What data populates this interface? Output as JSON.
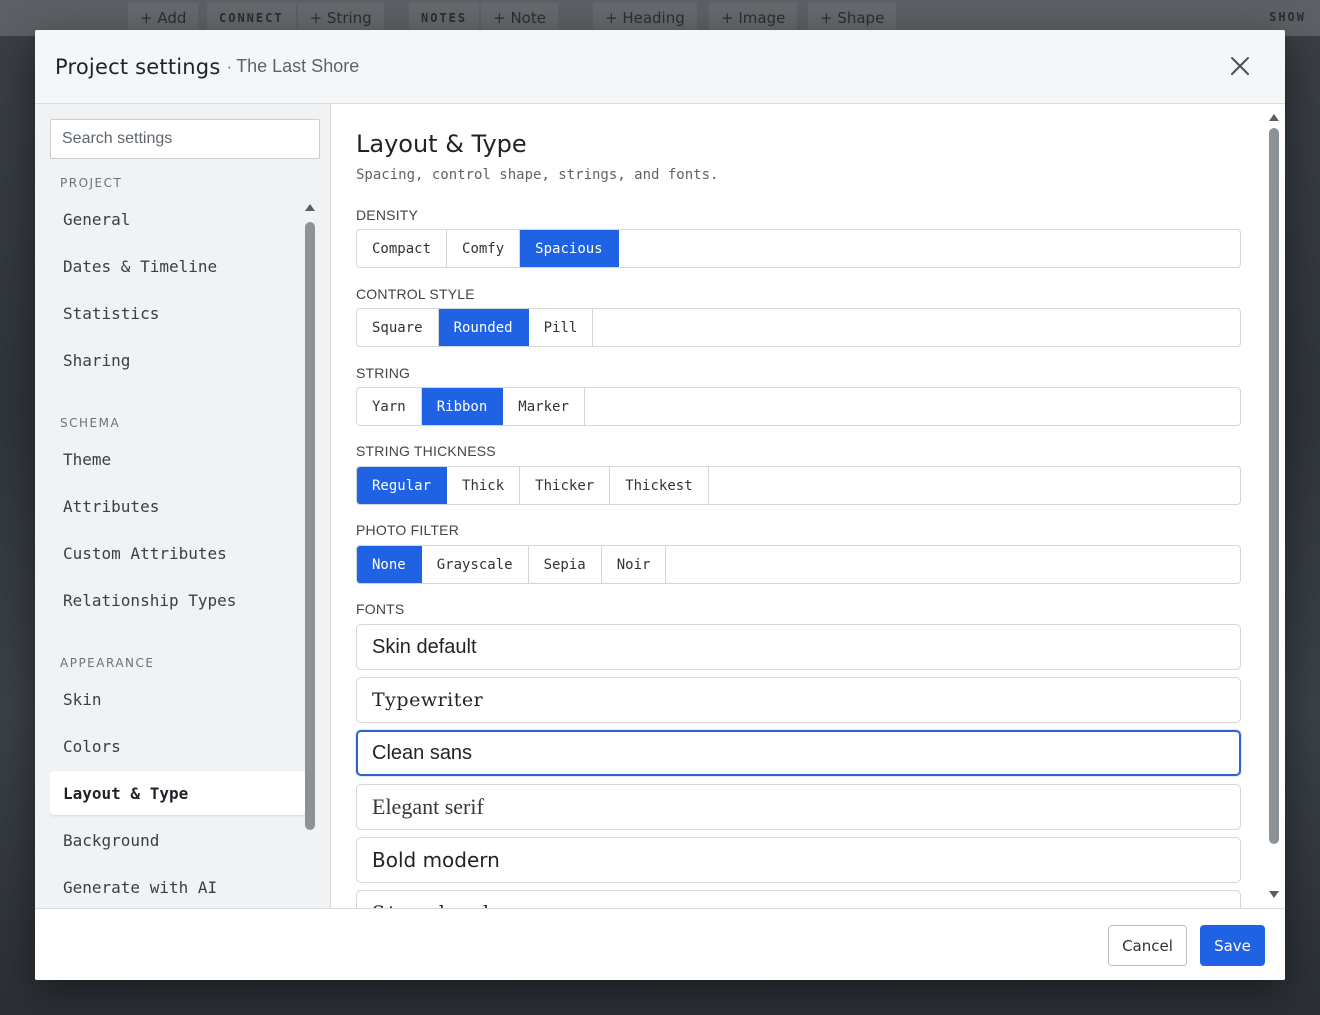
{
  "toolbar": {
    "add_label": "+ Add",
    "connect_label": "CONNECT",
    "string_label": "+ String",
    "notes_label": "NOTES",
    "note_label": "+ Note",
    "heading_label": "+ Heading",
    "image_label": "+ Image",
    "shape_label": "+ Shape",
    "show_label": "SHOW"
  },
  "modal": {
    "title": "Project settings",
    "separator": "·",
    "subtitle": "The Last Shore",
    "close_icon": "close-icon"
  },
  "sidebar": {
    "search_placeholder": "Search settings",
    "sections": [
      {
        "title": "PROJECT",
        "items": [
          "General",
          "Dates & Timeline",
          "Statistics",
          "Sharing"
        ]
      },
      {
        "title": "SCHEMA",
        "items": [
          "Theme",
          "Attributes",
          "Custom Attributes",
          "Relationship Types"
        ]
      },
      {
        "title": "APPEARANCE",
        "items": [
          "Skin",
          "Colors",
          "Layout & Type",
          "Background",
          "Generate with AI"
        ]
      }
    ],
    "active_item": "Layout & Type"
  },
  "main": {
    "title": "Layout & Type",
    "description": "Spacing, control shape, strings, and fonts.",
    "density": {
      "label": "DENSITY",
      "options": [
        "Compact",
        "Comfy",
        "Spacious"
      ],
      "selected": "Spacious"
    },
    "control_style": {
      "label": "CONTROL STYLE",
      "options": [
        "Square",
        "Rounded",
        "Pill"
      ],
      "selected": "Rounded"
    },
    "string": {
      "label": "STRING",
      "options": [
        "Yarn",
        "Ribbon",
        "Marker"
      ],
      "selected": "Ribbon"
    },
    "string_thickness": {
      "label": "STRING THICKNESS",
      "options": [
        "Regular",
        "Thick",
        "Thicker",
        "Thickest"
      ],
      "selected": "Regular"
    },
    "photo_filter": {
      "label": "PHOTO FILTER",
      "options": [
        "None",
        "Grayscale",
        "Sepia",
        "Noir"
      ],
      "selected": "None"
    },
    "fonts": {
      "label": "FONTS",
      "options": [
        "Skin default",
        "Typewriter",
        "Clean sans",
        "Elegant serif",
        "Bold modern",
        "Storybook"
      ],
      "selected": "Clean sans"
    }
  },
  "footer": {
    "cancel_label": "Cancel",
    "save_label": "Save"
  },
  "colors": {
    "accent": "#1f63e4",
    "selected_border": "#2c62d8",
    "sidebar_bg": "#f0f2f3",
    "header_bg": "#f5f6f7"
  }
}
